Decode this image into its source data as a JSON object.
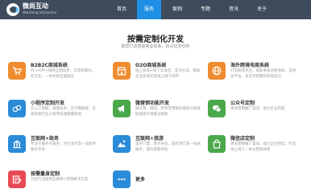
{
  "brand": {
    "name": "微尚互动",
    "subtitle": "Weishang Interactive"
  },
  "nav": [
    {
      "label": "首页"
    },
    {
      "label": "服务"
    },
    {
      "label": "案例"
    },
    {
      "label": "专题"
    },
    {
      "label": "资讯"
    },
    {
      "label": "关于"
    }
  ],
  "active_nav": "服务",
  "colors": {
    "topbar": "#3d4b5c",
    "accent": "#1e8fe5",
    "orange": "#f08c30",
    "green": "#4aa84a",
    "blue": "#2a8bd8",
    "red": "#e84a55"
  },
  "page": {
    "title": "按需定制化开发",
    "subtitle": "助您打造智能商业体系，抢占社交红利"
  },
  "services": [
    {
      "title": "B2B2C商城系统",
      "desc": "PC+APP+微商全网同步，实现跨端化，社交化，一体化和全面融合",
      "color": "#f08c30",
      "icon": "cart-icon"
    },
    {
      "title": "O2O商城系统",
      "desc": "线上商城+线下实体店，互为引流，帮助企业快速实现线上线下闭环",
      "color": "#f08c30",
      "icon": "store-icon"
    },
    {
      "title": "海外跨境电商系统",
      "desc": "打造跨境平台，帮助系统对接海关，支持多平台，多货币结算和跨境支付",
      "color": "#f08c30",
      "icon": "globe-icon"
    },
    {
      "title": "小程序定制开发",
      "desc": "引入工智能，海量技术，云计算赋能，实现各类行业小程序快速部署落地",
      "color": "#2a8bd8",
      "icon": "miniapp-icon"
    },
    {
      "title": "微营销功能开发",
      "desc": "微分销、拼团、秒杀等营销功能助力商家快速提升销量与粘性",
      "color": "#4aa84a",
      "icon": "megaphone-icon"
    },
    {
      "title": "公众号定制",
      "desc": "更多营销推广渠道，助力企业转型",
      "color": "#4aa84a",
      "icon": "wechat-icon"
    },
    {
      "title": "互联网+政务",
      "desc": "专注于服务于政务，为行业打造一流政务服务平台",
      "color": "#2a8bd8",
      "icon": "government-icon"
    },
    {
      "title": "互联网+旅游",
      "desc": "电子门票、景点导览、酒店预订等一站式服务，提升游客体验",
      "color": "#2a8bd8",
      "icon": "travel-icon"
    },
    {
      "title": "微信店定制",
      "desc": "更多营销推广渠道，助力企业转型，打造线上线下一体化营销体系",
      "color": "#4aa84a",
      "icon": "shop-icon"
    },
    {
      "title": "按需量身定制",
      "desc": "为您行业提供互联网+营销解决方案",
      "color": "#e84a55",
      "icon": "custom-icon"
    },
    {
      "title": "更多",
      "desc": "",
      "color": "#2a8bd8",
      "icon": "more-icon"
    }
  ]
}
